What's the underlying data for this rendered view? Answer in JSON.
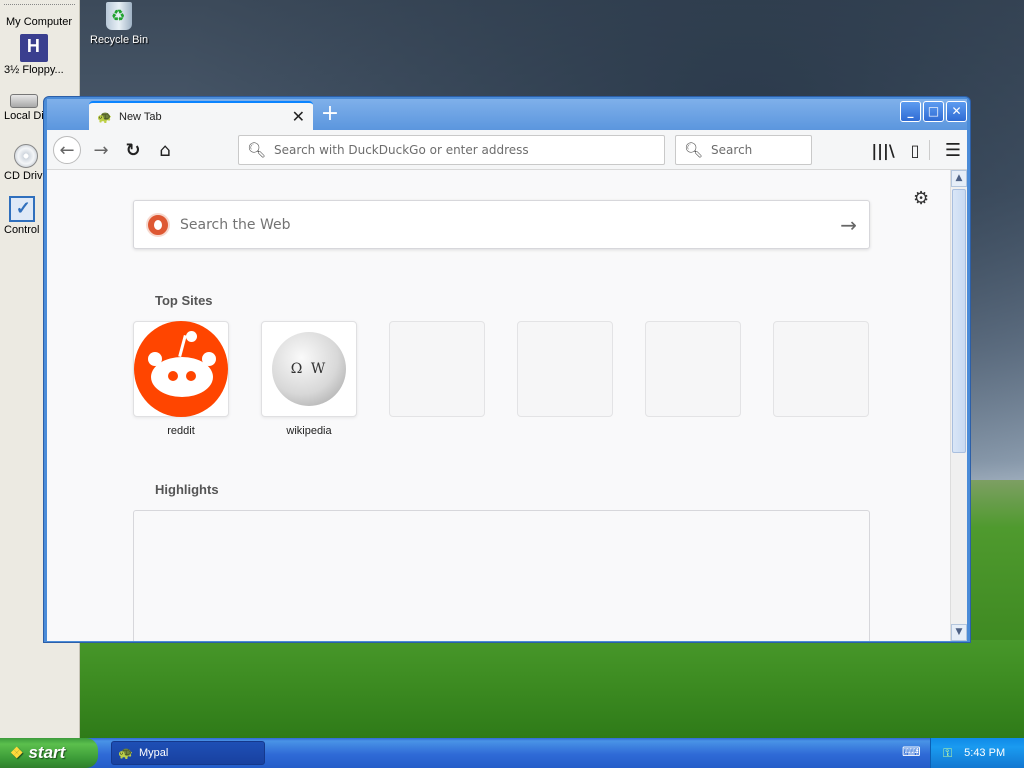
{
  "desktop": {
    "icons": [
      {
        "label": "My Computer"
      },
      {
        "label": "3½ Floppy..."
      },
      {
        "label": "Local Di"
      },
      {
        "label": "CD Drive"
      },
      {
        "label": "Control"
      },
      {
        "label": "Recycle Bin"
      }
    ]
  },
  "browser": {
    "tab": {
      "title": "New Tab",
      "close": "✕"
    },
    "new_tab": "+",
    "window_buttons": {
      "minimize": "_",
      "maximize": "□",
      "close": "✕"
    },
    "nav": {
      "back": "←",
      "forward": "→",
      "reload": "↻",
      "home": "⌂"
    },
    "url_placeholder": "Search with DuckDuckGo or enter address",
    "search_placeholder": "Search",
    "toolbar": {
      "library": "|||\\",
      "sidebar": "▯",
      "menu": "☰"
    }
  },
  "newtab": {
    "web_search_placeholder": "Search the Web",
    "go_arrow": "→",
    "settings_icon": "⚙",
    "top_sites_title": "Top Sites",
    "top_sites": [
      {
        "label": "reddit",
        "icon": "reddit-logo"
      },
      {
        "label": "wikipedia",
        "icon": "wikipedia-logo"
      },
      {
        "label": ""
      },
      {
        "label": ""
      },
      {
        "label": ""
      },
      {
        "label": ""
      }
    ],
    "highlights_title": "Highlights"
  },
  "taskbar": {
    "start_label": "start",
    "app_label": "Mypal",
    "clock": "5:43 PM"
  }
}
